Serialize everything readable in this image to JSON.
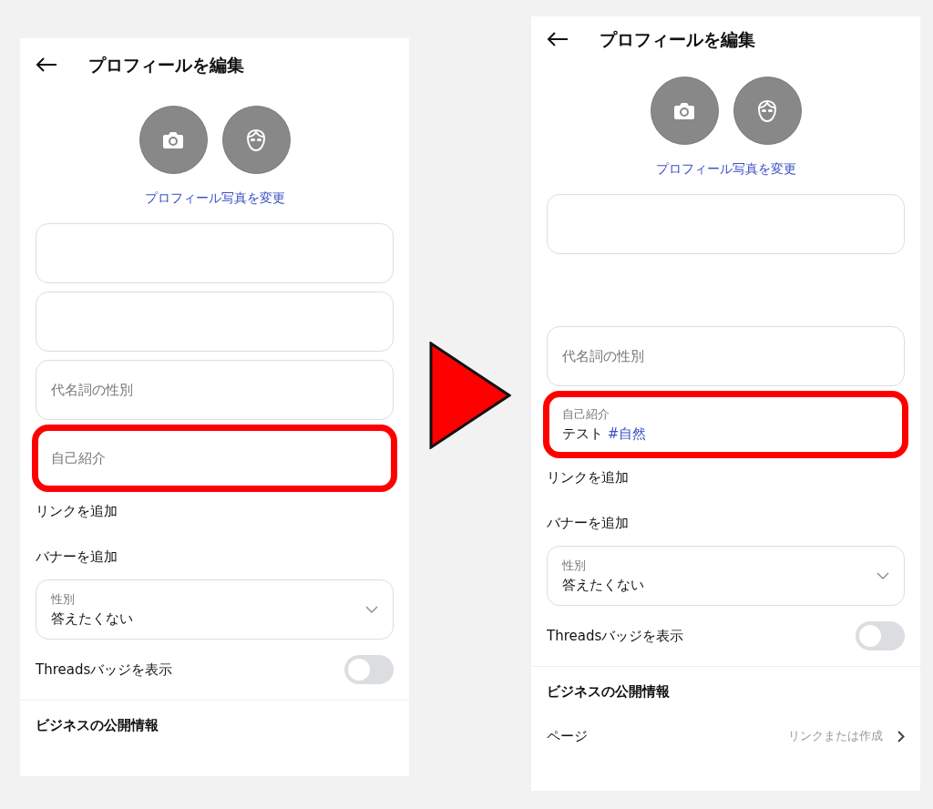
{
  "screens": [
    {
      "title": "プロフィールを編集",
      "photo_link": "プロフィール写真を変更",
      "fields": [
        {
          "kind": "blank"
        },
        {
          "kind": "blank"
        },
        {
          "kind": "text",
          "placeholder": "代名詞の性別"
        },
        {
          "kind": "bio",
          "placeholder": "自己紹介",
          "highlighted": true
        }
      ],
      "links": [
        "リンクを追加",
        "バナーを追加"
      ],
      "gender": {
        "label": "性別",
        "value": "答えたくない"
      },
      "toggle": {
        "label": "Threadsバッジを表示",
        "on": false
      },
      "section": "ビジネスの公開情報"
    },
    {
      "title": "プロフィールを編集",
      "photo_link": "プロフィール写真を変更",
      "fields": [
        {
          "kind": "blank"
        },
        {
          "kind": "gap"
        },
        {
          "kind": "text",
          "placeholder": "代名詞の性別"
        },
        {
          "kind": "bio",
          "label": "自己紹介",
          "value": "テスト",
          "hashtag": "#自然",
          "highlighted": true
        }
      ],
      "links": [
        "リンクを追加",
        "バナーを追加"
      ],
      "gender": {
        "label": "性別",
        "value": "答えたくない"
      },
      "toggle": {
        "label": "Threadsバッジを表示",
        "on": false
      },
      "section": "ビジネスの公開情報",
      "page_row": {
        "label": "ページ",
        "value": "リンクまたは作成"
      }
    }
  ]
}
